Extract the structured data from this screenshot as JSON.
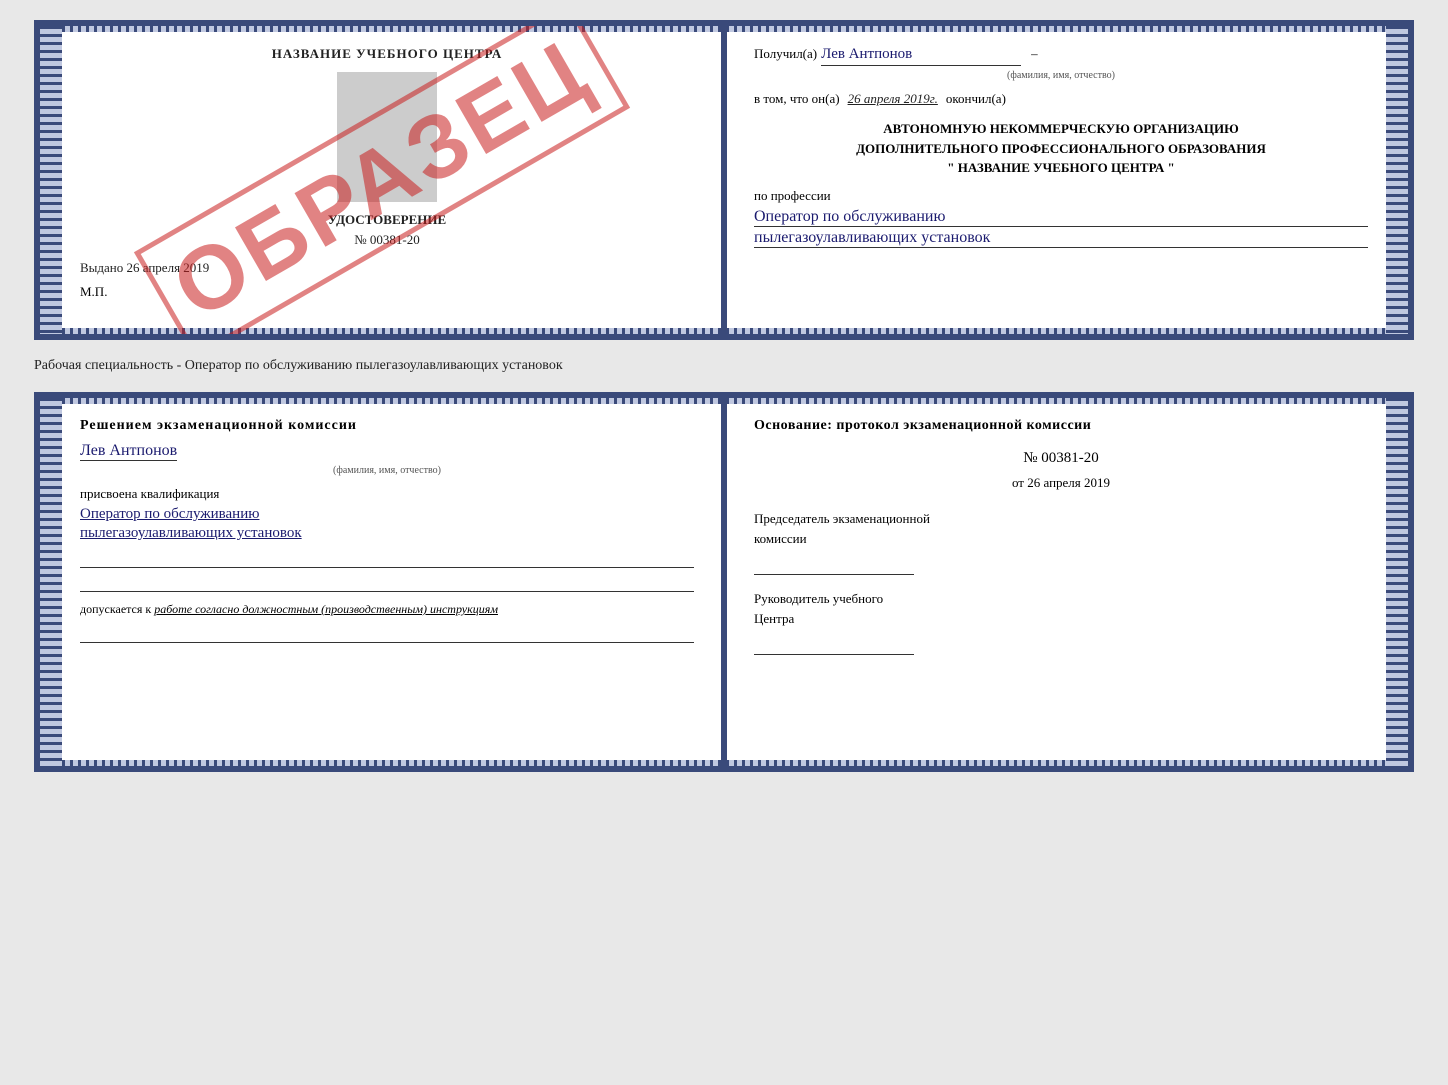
{
  "top_cert": {
    "left_page": {
      "title": "НАЗВАНИЕ УЧЕБНОГО ЦЕНТРА",
      "obrazets_text": "ОБРАЗЕЦ",
      "udostoverenie_label": "УДОСТОВЕРЕНИЕ",
      "cert_number": "№ 00381-20",
      "vydano_label": "Выдано",
      "vydano_date": "26 апреля 2019",
      "mp_label": "М.П."
    },
    "right_page": {
      "poluchil_label": "Получил(а)",
      "recipient_name": "Лев Антпонов",
      "fio_hint": "(фамилия, имя, отчество)",
      "vtom_label": "в том, что он(а)",
      "completion_date": "26 апреля 2019г.",
      "okonchil_label": "окончил(а)",
      "org_line1": "АВТОНОМНУЮ НЕКОММЕРЧЕСКУЮ ОРГАНИЗАЦИЮ",
      "org_line2": "ДОПОЛНИТЕЛЬНОГО ПРОФЕССИОНАЛЬНОГО ОБРАЗОВАНИЯ",
      "org_quote_open": "\"",
      "org_name": "НАЗВАНИЕ УЧЕБНОГО ЦЕНТРА",
      "org_quote_close": "\"",
      "po_professii_label": "по профессии",
      "profession_line1": "Оператор по обслуживанию",
      "profession_line2": "пылегазоулавливающих установок"
    }
  },
  "separator": {
    "text": "Рабочая специальность - Оператор по обслуживанию пылегазоулавливающих установок"
  },
  "bottom_cert": {
    "left_page": {
      "resheniem_label": "Решением экзаменационной комиссии",
      "komissia_name": "Лев Антпонов",
      "fio_hint": "(фамилия, имя, отчество)",
      "prisvoena_label": "присвоена квалификация",
      "kval_line1": "Оператор по обслуживанию",
      "kval_line2": "пылегазоулавливающих установок",
      "dopusk_label": "допускается к",
      "dopusk_text": "работе согласно должностным (производственным) инструкциям"
    },
    "right_page": {
      "osnovanie_label": "Основание: протокол экзаменационной комиссии",
      "protocol_number": "№ 00381-20",
      "ot_label": "от",
      "ot_date": "26 апреля 2019",
      "predsedatel_line1": "Председатель экзаменационной",
      "predsedatel_line2": "комиссии",
      "rukovoditel_line1": "Руководитель учебного",
      "rukovoditel_line2": "Центра"
    }
  }
}
